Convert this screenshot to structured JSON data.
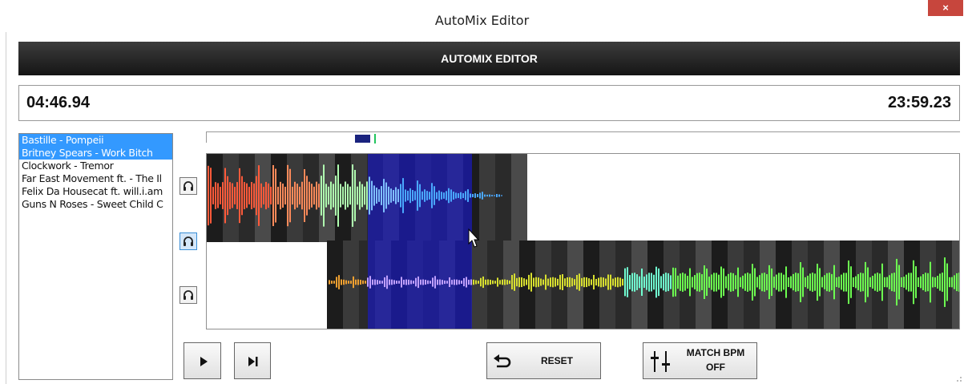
{
  "window": {
    "title": "AutoMix Editor",
    "close_label": "×"
  },
  "header": {
    "title": "AUTOMIX EDITOR"
  },
  "times": {
    "current": "04:46.94",
    "total": "23:59.23"
  },
  "tracklist": {
    "items": [
      {
        "label": "Bastille - Pompeii",
        "selected": true
      },
      {
        "label": "Britney Spears - Work Bitch",
        "selected": true
      },
      {
        "label": "Clockwork - Tremor",
        "selected": false
      },
      {
        "label": "Far East Movement ft. - The Il",
        "selected": false
      },
      {
        "label": "Felix Da Housecat ft. will.i.am",
        "selected": false
      },
      {
        "label": "Guns N Roses - Sweet Child C",
        "selected": false
      }
    ]
  },
  "controls": {
    "play_icon": "play-icon",
    "skip_icon": "skip-next-icon",
    "reset_label": "RESET",
    "match_bpm_line1": "MATCH BPM",
    "match_bpm_line2": "OFF"
  },
  "colors": {
    "selection": "#3399ff",
    "mix_region": "#1a1ab8",
    "close": "#c7463d",
    "header_bg": "#1c1c1c"
  }
}
